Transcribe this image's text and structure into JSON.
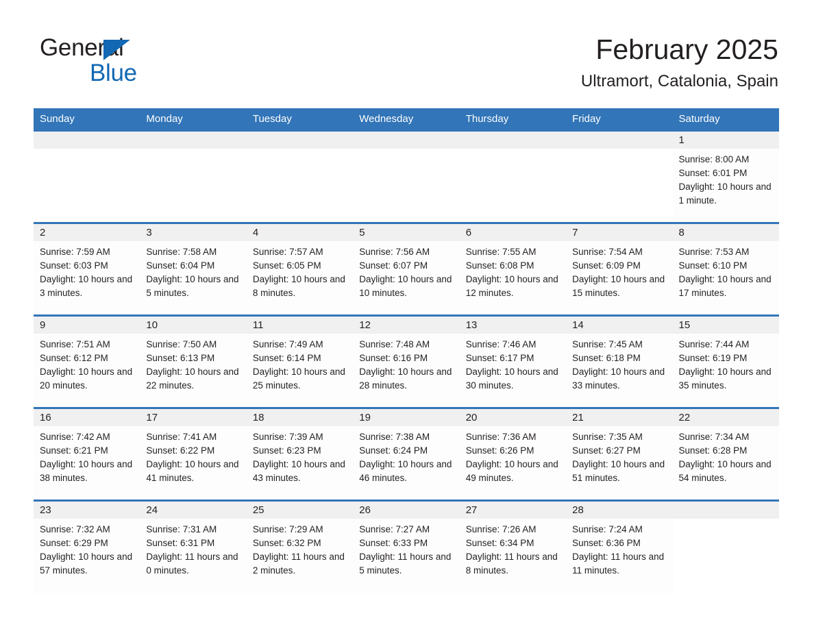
{
  "brand": {
    "name_part1": "General",
    "name_part2": "Blue",
    "triangle_icon": "triangle-icon",
    "color_primary": "#1268b3",
    "color_text": "#231f20"
  },
  "header": {
    "title": "February 2025",
    "subtitle": "Ultramort, Catalonia, Spain"
  },
  "calendar": {
    "header_bg": "#3275b8",
    "row_border": "#3275b8",
    "daybar_bg": "#f0f0f0",
    "weekdays": [
      "Sunday",
      "Monday",
      "Tuesday",
      "Wednesday",
      "Thursday",
      "Friday",
      "Saturday"
    ],
    "weeks": [
      [
        {
          "day": ""
        },
        {
          "day": ""
        },
        {
          "day": ""
        },
        {
          "day": ""
        },
        {
          "day": ""
        },
        {
          "day": ""
        },
        {
          "day": "1",
          "sunrise": "Sunrise: 8:00 AM",
          "sunset": "Sunset: 6:01 PM",
          "daylight": "Daylight: 10 hours and 1 minute."
        }
      ],
      [
        {
          "day": "2",
          "sunrise": "Sunrise: 7:59 AM",
          "sunset": "Sunset: 6:03 PM",
          "daylight": "Daylight: 10 hours and 3 minutes."
        },
        {
          "day": "3",
          "sunrise": "Sunrise: 7:58 AM",
          "sunset": "Sunset: 6:04 PM",
          "daylight": "Daylight: 10 hours and 5 minutes."
        },
        {
          "day": "4",
          "sunrise": "Sunrise: 7:57 AM",
          "sunset": "Sunset: 6:05 PM",
          "daylight": "Daylight: 10 hours and 8 minutes."
        },
        {
          "day": "5",
          "sunrise": "Sunrise: 7:56 AM",
          "sunset": "Sunset: 6:07 PM",
          "daylight": "Daylight: 10 hours and 10 minutes."
        },
        {
          "day": "6",
          "sunrise": "Sunrise: 7:55 AM",
          "sunset": "Sunset: 6:08 PM",
          "daylight": "Daylight: 10 hours and 12 minutes."
        },
        {
          "day": "7",
          "sunrise": "Sunrise: 7:54 AM",
          "sunset": "Sunset: 6:09 PM",
          "daylight": "Daylight: 10 hours and 15 minutes."
        },
        {
          "day": "8",
          "sunrise": "Sunrise: 7:53 AM",
          "sunset": "Sunset: 6:10 PM",
          "daylight": "Daylight: 10 hours and 17 minutes."
        }
      ],
      [
        {
          "day": "9",
          "sunrise": "Sunrise: 7:51 AM",
          "sunset": "Sunset: 6:12 PM",
          "daylight": "Daylight: 10 hours and 20 minutes."
        },
        {
          "day": "10",
          "sunrise": "Sunrise: 7:50 AM",
          "sunset": "Sunset: 6:13 PM",
          "daylight": "Daylight: 10 hours and 22 minutes."
        },
        {
          "day": "11",
          "sunrise": "Sunrise: 7:49 AM",
          "sunset": "Sunset: 6:14 PM",
          "daylight": "Daylight: 10 hours and 25 minutes."
        },
        {
          "day": "12",
          "sunrise": "Sunrise: 7:48 AM",
          "sunset": "Sunset: 6:16 PM",
          "daylight": "Daylight: 10 hours and 28 minutes."
        },
        {
          "day": "13",
          "sunrise": "Sunrise: 7:46 AM",
          "sunset": "Sunset: 6:17 PM",
          "daylight": "Daylight: 10 hours and 30 minutes."
        },
        {
          "day": "14",
          "sunrise": "Sunrise: 7:45 AM",
          "sunset": "Sunset: 6:18 PM",
          "daylight": "Daylight: 10 hours and 33 minutes."
        },
        {
          "day": "15",
          "sunrise": "Sunrise: 7:44 AM",
          "sunset": "Sunset: 6:19 PM",
          "daylight": "Daylight: 10 hours and 35 minutes."
        }
      ],
      [
        {
          "day": "16",
          "sunrise": "Sunrise: 7:42 AM",
          "sunset": "Sunset: 6:21 PM",
          "daylight": "Daylight: 10 hours and 38 minutes."
        },
        {
          "day": "17",
          "sunrise": "Sunrise: 7:41 AM",
          "sunset": "Sunset: 6:22 PM",
          "daylight": "Daylight: 10 hours and 41 minutes."
        },
        {
          "day": "18",
          "sunrise": "Sunrise: 7:39 AM",
          "sunset": "Sunset: 6:23 PM",
          "daylight": "Daylight: 10 hours and 43 minutes."
        },
        {
          "day": "19",
          "sunrise": "Sunrise: 7:38 AM",
          "sunset": "Sunset: 6:24 PM",
          "daylight": "Daylight: 10 hours and 46 minutes."
        },
        {
          "day": "20",
          "sunrise": "Sunrise: 7:36 AM",
          "sunset": "Sunset: 6:26 PM",
          "daylight": "Daylight: 10 hours and 49 minutes."
        },
        {
          "day": "21",
          "sunrise": "Sunrise: 7:35 AM",
          "sunset": "Sunset: 6:27 PM",
          "daylight": "Daylight: 10 hours and 51 minutes."
        },
        {
          "day": "22",
          "sunrise": "Sunrise: 7:34 AM",
          "sunset": "Sunset: 6:28 PM",
          "daylight": "Daylight: 10 hours and 54 minutes."
        }
      ],
      [
        {
          "day": "23",
          "sunrise": "Sunrise: 7:32 AM",
          "sunset": "Sunset: 6:29 PM",
          "daylight": "Daylight: 10 hours and 57 minutes."
        },
        {
          "day": "24",
          "sunrise": "Sunrise: 7:31 AM",
          "sunset": "Sunset: 6:31 PM",
          "daylight": "Daylight: 11 hours and 0 minutes."
        },
        {
          "day": "25",
          "sunrise": "Sunrise: 7:29 AM",
          "sunset": "Sunset: 6:32 PM",
          "daylight": "Daylight: 11 hours and 2 minutes."
        },
        {
          "day": "26",
          "sunrise": "Sunrise: 7:27 AM",
          "sunset": "Sunset: 6:33 PM",
          "daylight": "Daylight: 11 hours and 5 minutes."
        },
        {
          "day": "27",
          "sunrise": "Sunrise: 7:26 AM",
          "sunset": "Sunset: 6:34 PM",
          "daylight": "Daylight: 11 hours and 8 minutes."
        },
        {
          "day": "28",
          "sunrise": "Sunrise: 7:24 AM",
          "sunset": "Sunset: 6:36 PM",
          "daylight": "Daylight: 11 hours and 11 minutes."
        },
        {
          "day": ""
        }
      ]
    ]
  }
}
